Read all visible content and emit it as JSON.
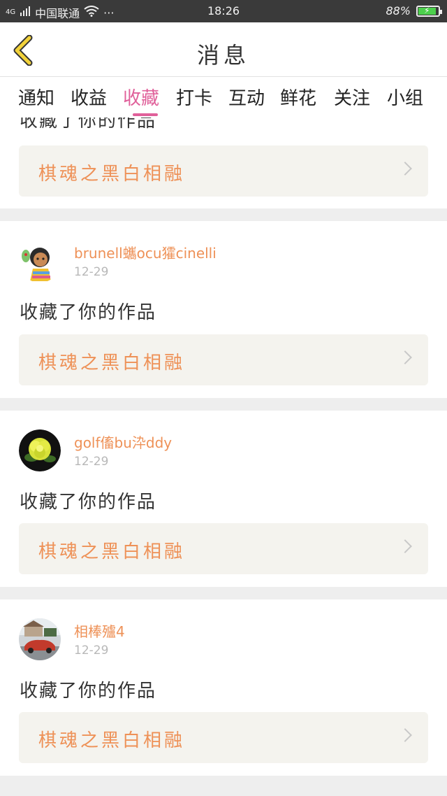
{
  "status_bar": {
    "network": "4G",
    "carrier": "中国联通",
    "more": "···",
    "time": "18:26",
    "battery_percent": "88%",
    "battery_level": 0.88
  },
  "header": {
    "title": "消息"
  },
  "tabs": [
    {
      "label": "通知",
      "active": false
    },
    {
      "label": "收益",
      "active": false
    },
    {
      "label": "收藏",
      "active": true
    },
    {
      "label": "打卡",
      "active": false
    },
    {
      "label": "互动",
      "active": false
    },
    {
      "label": "鲜花",
      "active": false
    },
    {
      "label": "关注",
      "active": false
    },
    {
      "label": "小组",
      "active": false
    }
  ],
  "feed": {
    "partial_top": {
      "action": "收藏了你的作品",
      "work_title": "棋魂之黑白相融"
    },
    "items": [
      {
        "user": "brunell蠵ocu㺢cinelli",
        "date": "12-29",
        "action": "收藏了你的作品",
        "work_title": "棋魂之黑白相融",
        "avatar": "cartoon-girl-avatar"
      },
      {
        "user": "golf傗bu㳃ddy",
        "date": "12-29",
        "action": "收藏了你的作品",
        "work_title": "棋魂之黑白相融",
        "avatar": "yellow-flower-avatar"
      },
      {
        "user": "相棒㱺4",
        "date": "12-29",
        "action": "收藏了你的作品",
        "work_title": "棋魂之黑白相融",
        "avatar": "red-car-avatar"
      }
    ]
  },
  "colors": {
    "accent_pink": "#e0609a",
    "username_orange": "#ee9157",
    "work_title_orange": "#ee9157",
    "back_icon_yellow": "#f2d23a"
  }
}
